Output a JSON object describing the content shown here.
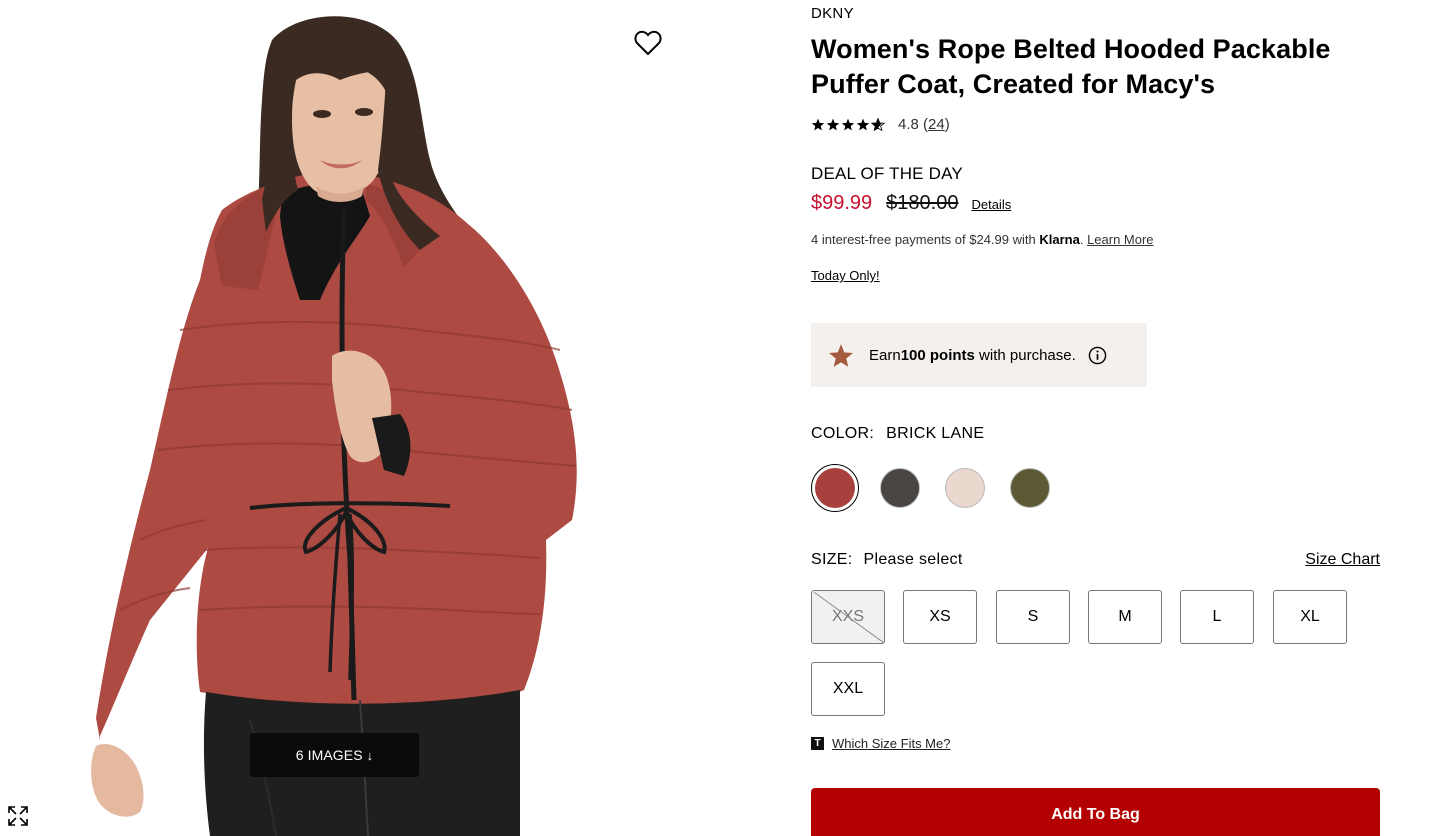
{
  "gallery": {
    "images_label": "6 IMAGES",
    "images_arrow": "↓",
    "wishlist_icon": "heart-outline-icon",
    "expand_icon": "expand-arrows-icon"
  },
  "product": {
    "brand": "DKNY",
    "title": "Women's Rope Belted Hooded Packable Puffer Coat, Created for Macy's",
    "rating": {
      "value": "4.8",
      "count": "24",
      "stars": 4.8
    },
    "deal_label": "DEAL OF THE DAY",
    "sale_price": "$99.99",
    "original_price": "$180.00",
    "details_link": "Details",
    "klarna": {
      "prefix": "4 interest-free payments of $24.99 with ",
      "brand": "Klarna",
      "suffix": ". ",
      "learn_more": "Learn More"
    },
    "today_only": "Today Only!",
    "points": {
      "prefix": "Earn ",
      "amount": "100 points",
      "suffix": " with purchase."
    },
    "color": {
      "label": "COLOR:",
      "selected_name": "BRICK LANE",
      "swatches": [
        {
          "name": "brick-lane",
          "hex": "#a8413d",
          "selected": true
        },
        {
          "name": "charcoal",
          "hex": "#4a4543",
          "selected": false
        },
        {
          "name": "blush",
          "hex": "#ead8cf",
          "selected": false
        },
        {
          "name": "olive",
          "hex": "#5b5a35",
          "selected": false
        }
      ]
    },
    "size": {
      "label": "SIZE:",
      "value": "Please select",
      "chart_link": "Size Chart",
      "options": [
        {
          "label": "XXS",
          "available": false
        },
        {
          "label": "XS",
          "available": true
        },
        {
          "label": "S",
          "available": true
        },
        {
          "label": "M",
          "available": true
        },
        {
          "label": "L",
          "available": true
        },
        {
          "label": "XL",
          "available": true
        },
        {
          "label": "XXL",
          "available": true
        }
      ]
    },
    "fit_link": "Which Size Fits Me?",
    "fit_icon_letter": "T",
    "add_to_bag": "Add To Bag"
  },
  "colors": {
    "sale": "#c8102e",
    "cta": "#b30000",
    "points_bg": "#f4f0ed",
    "coat": "#b04b43",
    "points_star": "#a45a3c"
  }
}
